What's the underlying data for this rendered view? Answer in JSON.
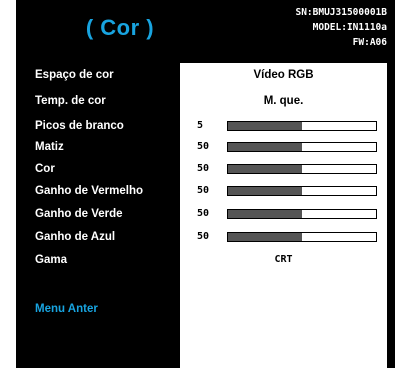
{
  "menu": {
    "title": "( Cor )",
    "info": {
      "serial": "SN:BMUJ31500001B",
      "model": "MODEL:IN1110a",
      "firmware": "FW:A06"
    },
    "items": [
      {
        "label": "Espaço de cor",
        "value": "Vídeo RGB"
      },
      {
        "label": "Temp. de cor",
        "value": "M. que."
      },
      {
        "label": "Picos de branco",
        "value": "5",
        "level": 0.5
      },
      {
        "label": "Matiz",
        "value": "50",
        "level": 0.5
      },
      {
        "label": "Cor",
        "value": "50",
        "level": 0.5
      },
      {
        "label": "Ganho de Vermelho",
        "value": "50",
        "level": 0.5
      },
      {
        "label": "Ganho de Verde",
        "value": "50",
        "level": 0.5
      },
      {
        "label": "Ganho de Azul",
        "value": "50",
        "level": 0.5
      },
      {
        "label": "Gama",
        "value": "CRT"
      }
    ],
    "back_label": "Menu Anter",
    "colors": {
      "accent": "#18a4e0",
      "background": "#000000",
      "value_panel": "#ffffff",
      "slider_fill": "#555555"
    }
  }
}
